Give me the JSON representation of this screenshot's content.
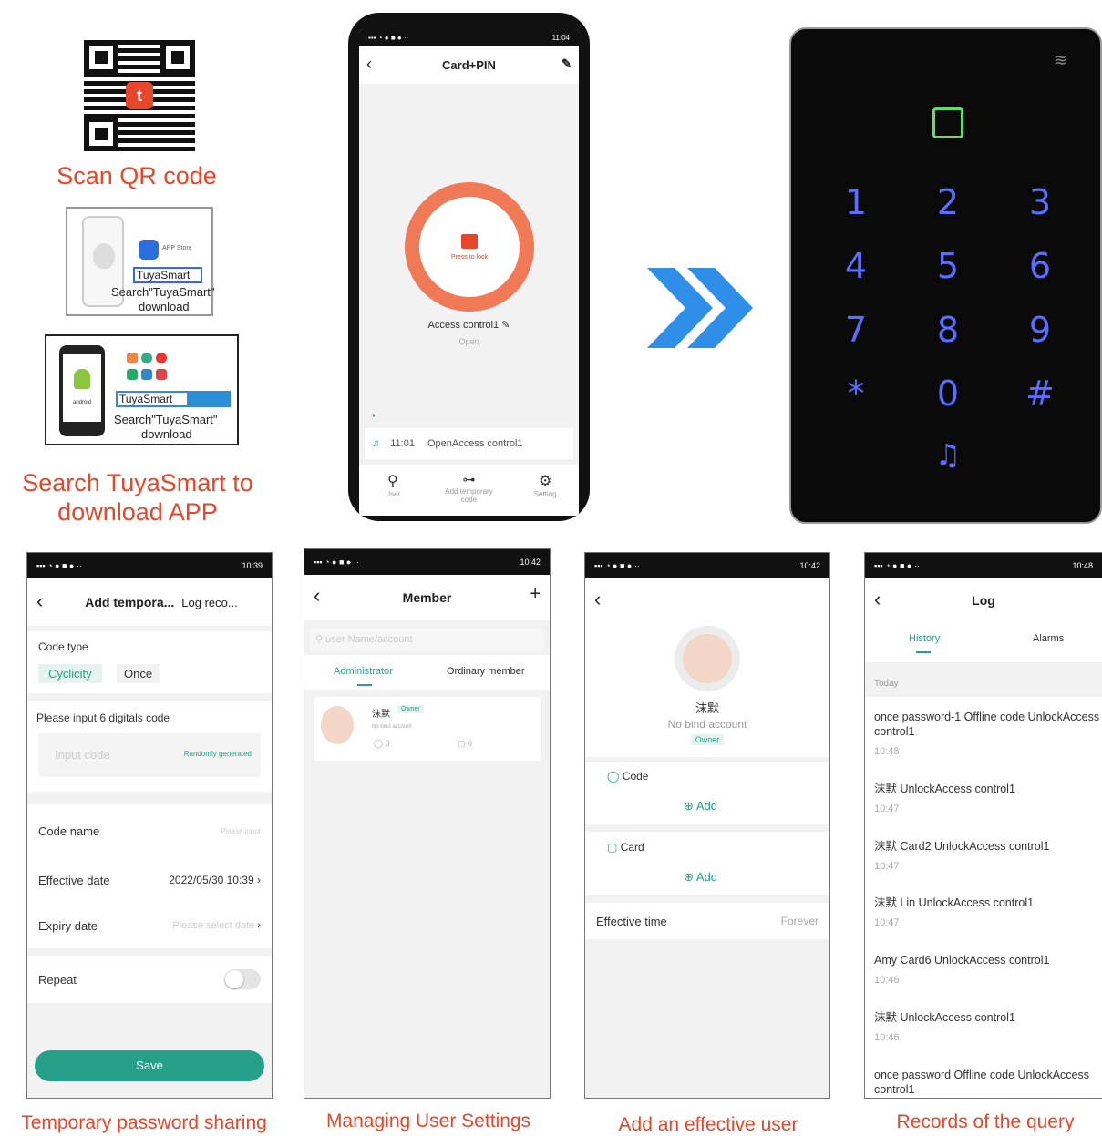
{
  "left": {
    "scan_caption": "Scan QR code",
    "apple_store": "APP Store",
    "apple_search_box": "TuyaSmart",
    "apple_search_text": "Search\"TuyaSmart\"",
    "apple_download": "download",
    "android_brand": "android",
    "android_search_box": "TuyaSmart",
    "android_search_text": "Search\"TuyaSmart\"",
    "android_download": "download",
    "search_caption_line1": "Search TuyaSmart to",
    "search_caption_line2": "download APP"
  },
  "main_phone": {
    "status_time": "11:04",
    "title": "Card+PIN",
    "press_to_lock": "Press to lock",
    "device_name": "Access control1",
    "state": "Open",
    "log_time": "11:01",
    "log_text": "OpenAccess control1",
    "nav": [
      {
        "label": "User"
      },
      {
        "label": "Add temporary code"
      },
      {
        "label": "Setting"
      }
    ]
  },
  "keypad": {
    "keys": [
      "1",
      "2",
      "3",
      "4",
      "5",
      "6",
      "7",
      "8",
      "9",
      "*",
      "0",
      "#"
    ]
  },
  "screen_temp": {
    "status_time": "10:39",
    "title": "Add tempora...",
    "right_tab": "Log reco...",
    "code_type_label": "Code type",
    "cyclicity": "Cyclicity",
    "once": "Once",
    "input_label": "Please input 6 digitals code",
    "input_placeholder": "Input code",
    "random": "Randomly generated",
    "code_name": "Code name",
    "code_name_placeholder": "Please input",
    "effective_date": "Effective date",
    "effective_value": "2022/05/30 10:39",
    "expiry_date": "Expiry date",
    "expiry_placeholder": "Please select date",
    "repeat": "Repeat",
    "save": "Save",
    "caption": "Temporary password sharing"
  },
  "screen_member": {
    "status_time": "10:42",
    "title": "Member",
    "search_placeholder": "user Name/account",
    "tab_admin": "Administrator",
    "tab_ordinary": "Ordinary member",
    "user_name": "沫默",
    "owner_badge": "Owner",
    "no_bind": "No bind account",
    "code_count": "0",
    "card_count": "0",
    "caption": "Managing User Settings"
  },
  "screen_user": {
    "status_time": "10:42",
    "name": "沫默",
    "no_bind": "No bind account",
    "owner": "Owner",
    "code_label": "Code",
    "add1": "Add",
    "card_label": "Card",
    "add2": "Add",
    "effective_time": "Effective time",
    "forever": "Forever",
    "caption": "Add an effective user"
  },
  "screen_log": {
    "status_time": "10:48",
    "title": "Log",
    "tab_history": "History",
    "tab_alarms": "Alarms",
    "today": "Today",
    "entries": [
      {
        "text": "once password-1 Offline code UnlockAccess control1",
        "time": "10:48"
      },
      {
        "text": "沫默  UnlockAccess control1",
        "time": "10:47"
      },
      {
        "text": "沫默 Card2 UnlockAccess control1",
        "time": "10:47"
      },
      {
        "text": "沫默 Lin UnlockAccess control1",
        "time": "10:47"
      },
      {
        "text": "Amy Card6 UnlockAccess control1",
        "time": "10:46"
      },
      {
        "text": "沫默  UnlockAccess control1",
        "time": "10:46"
      },
      {
        "text": "once password Offline code UnlockAccess control1",
        "time": ""
      }
    ],
    "caption": "Records of the query"
  },
  "colors": {
    "accent_red": "#e8462a",
    "teal": "#27a08a",
    "keypad_blue": "#5b6dff",
    "keypad_green": "#5de06a",
    "arrow_blue": "#2f8fe8"
  }
}
